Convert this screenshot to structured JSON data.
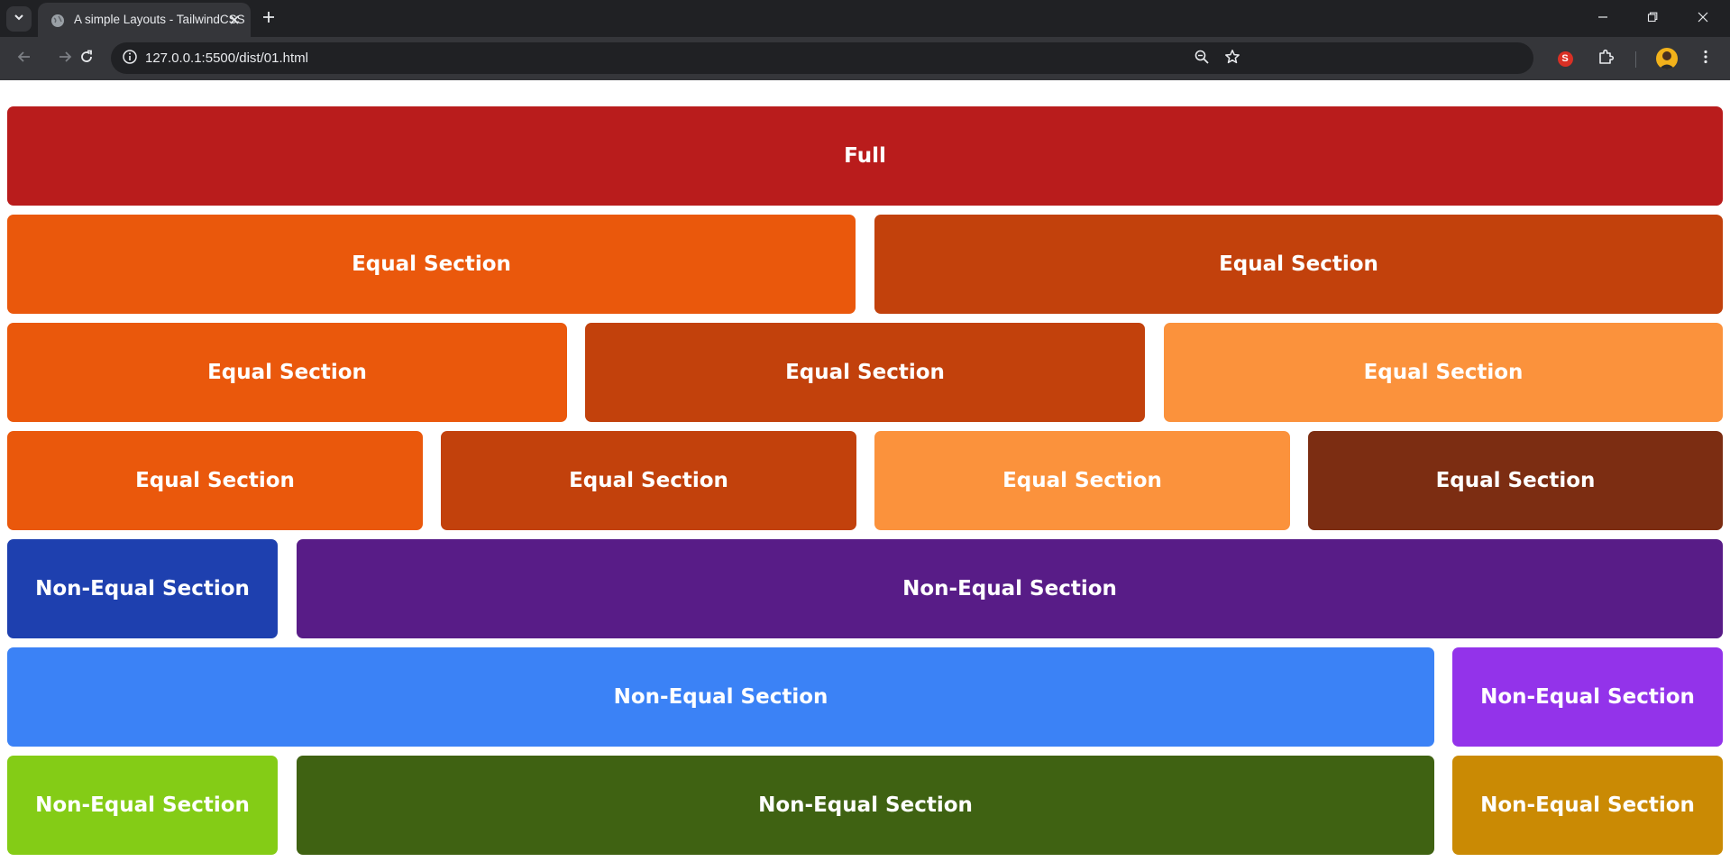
{
  "browser": {
    "tab_title": "A simple Layouts - TailwindCSS",
    "url": "127.0.0.1:5500/dist/01.html",
    "extension_badge": "S"
  },
  "icons": {
    "tab_search": "chevron-down-icon",
    "favicon": "globe-icon",
    "tab_close": "close-icon",
    "new_tab": "plus-icon",
    "minimize": "minimize-icon",
    "restore": "restore-icon",
    "window_close": "close-icon",
    "back": "arrow-left-icon",
    "forward": "arrow-right-icon",
    "reload": "reload-icon",
    "site_info": "info-icon",
    "zoom": "zoom-out-icon",
    "bookmark": "star-icon",
    "extensions": "puzzle-icon",
    "menu": "kebab-menu-icon"
  },
  "colors": {
    "red_700": "#b91c1c",
    "orange_600": "#ea580c",
    "orange_700": "#c2410c",
    "orange_400": "#fb923c",
    "orange_900": "#7c2d12",
    "blue_800": "#1e40af",
    "purple_900": "#581c87",
    "blue_500": "#3b82f6",
    "purple_600": "#9333ea",
    "lime_500": "#84cc16",
    "lime_900": "#3f6212",
    "yellow_600": "#ca8a04"
  },
  "rows": [
    {
      "sections": [
        {
          "label": "Full",
          "color": "#b91c1c"
        }
      ]
    },
    {
      "sections": [
        {
          "label": "Equal Section",
          "color": "#ea580c"
        },
        {
          "label": "Equal Section",
          "color": "#c2410c"
        }
      ]
    },
    {
      "sections": [
        {
          "label": "Equal Section",
          "color": "#ea580c"
        },
        {
          "label": "Equal Section",
          "color": "#c2410c"
        },
        {
          "label": "Equal Section",
          "color": "#fb923c"
        }
      ]
    },
    {
      "sections": [
        {
          "label": "Equal Section",
          "color": "#ea580c"
        },
        {
          "label": "Equal Section",
          "color": "#c2410c"
        },
        {
          "label": "Equal Section",
          "color": "#fb923c"
        },
        {
          "label": "Equal Section",
          "color": "#7c2d12"
        }
      ]
    },
    {
      "sections": [
        {
          "label": "Non-Equal Section",
          "color": "#1e40af"
        },
        {
          "label": "Non-Equal Section",
          "color": "#581c87"
        }
      ]
    },
    {
      "sections": [
        {
          "label": "Non-Equal Section",
          "color": "#3b82f6"
        },
        {
          "label": "Non-Equal Section",
          "color": "#9333ea"
        }
      ]
    },
    {
      "sections": [
        {
          "label": "Non-Equal Section",
          "color": "#84cc16"
        },
        {
          "label": "Non-Equal Section",
          "color": "#3f6212"
        },
        {
          "label": "Non-Equal Section",
          "color": "#ca8a04"
        }
      ]
    }
  ]
}
